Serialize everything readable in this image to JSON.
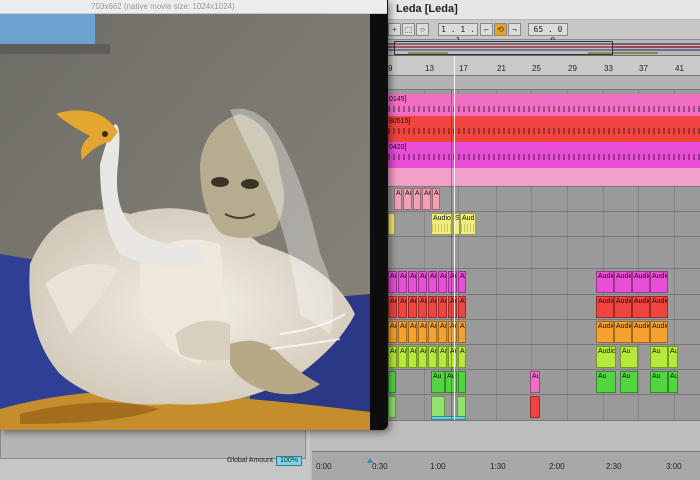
{
  "movie_window": {
    "caption": "703x662 (native movie size: 1024x1024)"
  },
  "daw": {
    "title": "Leda  [Leda]",
    "control_bar": {
      "position": "1 .   1 .   1",
      "end": "65 .   0 .   0",
      "loop_active_color": "#e8a21a"
    },
    "ruler_bars": [
      "9",
      "13",
      "17",
      "21",
      "25",
      "29",
      "33",
      "37",
      "41"
    ],
    "tracks": [
      {
        "label": "0145]",
        "color": "#e84fb6"
      },
      {
        "label": "80515]",
        "color": "#f0414a"
      },
      {
        "label": "0420]",
        "color": "#e84fe0"
      }
    ],
    "clip_label_audio": "Audio",
    "clip_label_au": "Au",
    "clip_label_aud": "Aud",
    "clip_label_s": "S",
    "bottom": {
      "global_amount_label": "Global Amount",
      "global_amount_value": "100%"
    },
    "timeline_labels": [
      "0:00",
      "0:30",
      "1:00",
      "1:30",
      "2:00",
      "2:30",
      "3:00"
    ]
  },
  "colors": {
    "pink": "#f26ec5",
    "red": "#f0443f",
    "magenta": "#e84fd6",
    "orange": "#f5a12f",
    "lime": "#b5e93a",
    "green": "#52d640",
    "lightgreen": "#8fe36e",
    "yellow": "#f2ee7a",
    "salmon": "#f3a0b4",
    "cyan": "#5fd0e0"
  }
}
